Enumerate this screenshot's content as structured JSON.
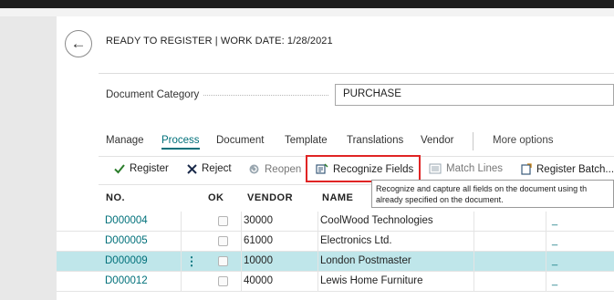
{
  "header": {
    "title": "READY TO REGISTER | WORK DATE: 1/28/2021",
    "back_icon": "back-arrow-icon"
  },
  "document_category": {
    "label": "Document Category",
    "value": "PURCHASE"
  },
  "menu": {
    "items": [
      "Manage",
      "Process",
      "Document",
      "Template",
      "Translations",
      "Vendor"
    ],
    "active": "Process",
    "more": "More options"
  },
  "actions": {
    "register": "Register",
    "reject": "Reject",
    "reopen": "Reopen",
    "recognize_fields": "Recognize Fields",
    "match_lines": "Match Lines",
    "register_batch": "Register Batch..."
  },
  "tooltip": {
    "line1": "Recognize and capture all fields on the document using th",
    "line2": "already specified on the document."
  },
  "table": {
    "columns": [
      "NO.",
      "OK",
      "VENDOR",
      "NAME"
    ],
    "rows": [
      {
        "no": "D000004",
        "vendor": "30000",
        "name": "CoolWood Technologies",
        "extra": "_"
      },
      {
        "no": "D000005",
        "vendor": "61000",
        "name": "Electronics Ltd.",
        "extra": "_"
      },
      {
        "no": "D000009",
        "vendor": "10000",
        "name": "London Postmaster",
        "extra": "_"
      },
      {
        "no": "D000012",
        "vendor": "40000",
        "name": "Lewis Home Furniture",
        "extra": "_"
      }
    ],
    "selected_row": 2
  },
  "colors": {
    "accent": "#00707a",
    "highlight_box": "#e02424",
    "selected_row": "#bfe6ea"
  }
}
